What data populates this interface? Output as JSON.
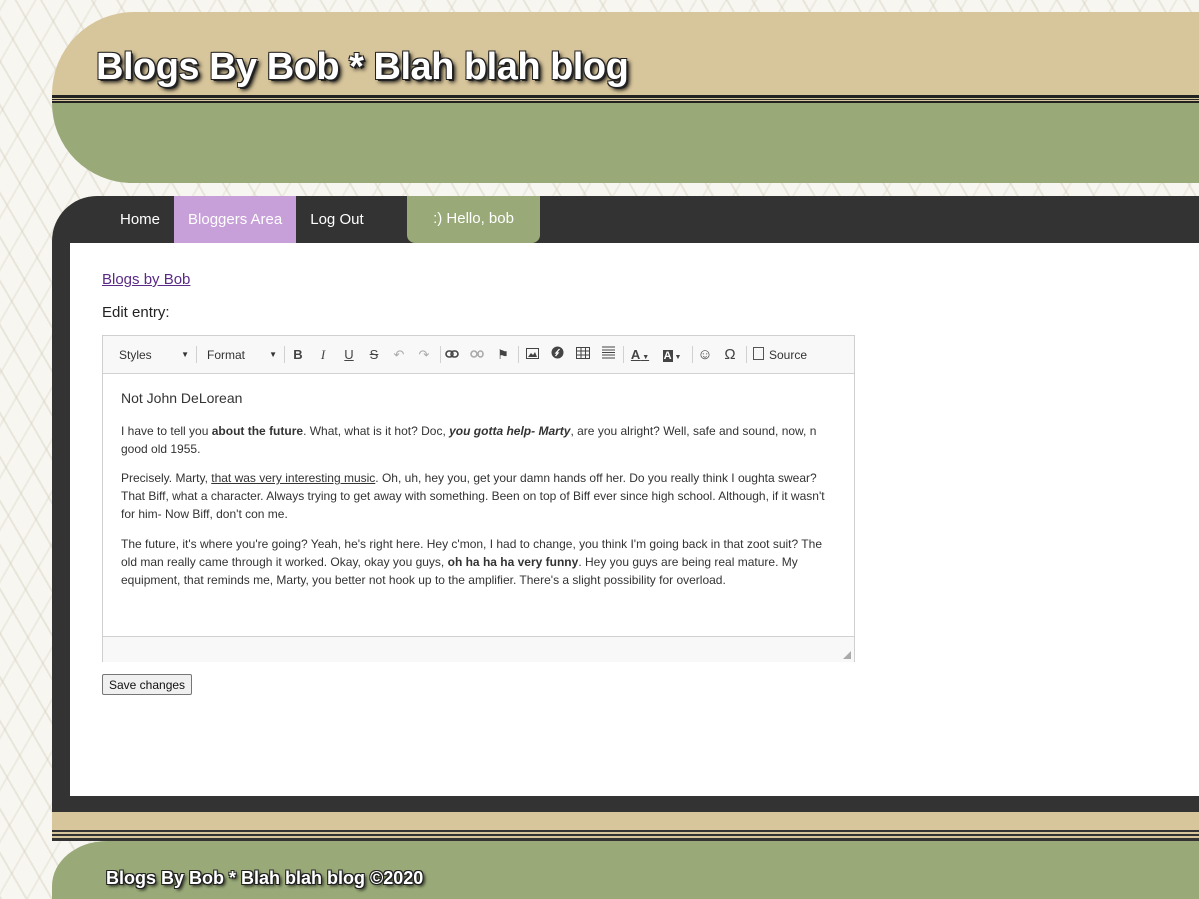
{
  "header": {
    "title": "Blogs By Bob * Blah blah blog"
  },
  "nav": {
    "items": [
      {
        "label": "Home",
        "active": false
      },
      {
        "label": "Bloggers Area",
        "active": true
      },
      {
        "label": "Log Out",
        "active": false
      }
    ],
    "greeting": ":)  Hello, bob"
  },
  "content": {
    "blog_link": "Blogs by Bob",
    "edit_label": "Edit entry:"
  },
  "editor": {
    "toolbar": {
      "styles_label": "Styles",
      "format_label": "Format",
      "source_label": "Source",
      "buttons": [
        "bold-icon",
        "italic-icon",
        "underline-icon",
        "strikethrough-icon",
        "undo-icon",
        "redo-icon",
        "link-icon",
        "unlink-icon",
        "anchor-flag-icon",
        "image-icon",
        "flash-icon",
        "table-icon",
        "horizontal-rule-icon",
        "text-color-icon",
        "background-color-icon",
        "smiley-icon",
        "special-char-icon"
      ]
    },
    "document": {
      "title": "Not John DeLorean",
      "p1": [
        {
          "text": "I have to tell you ",
          "style": "normal"
        },
        {
          "text": "about the future",
          "style": "bold"
        },
        {
          "text": ". What, what is it hot? Doc, ",
          "style": "normal"
        },
        {
          "text": "you gotta help- Marty",
          "style": "bold-italic"
        },
        {
          "text": ", are you alright? Well, safe and sound, now, n good old 1955.",
          "style": "normal"
        }
      ],
      "p2": [
        {
          "text": "Precisely. Marty, ",
          "style": "normal"
        },
        {
          "text": "that was very interesting music",
          "style": "underline"
        },
        {
          "text": ". Oh, uh, hey you, get your damn hands off her. Do you really think I oughta swear? That Biff, what a character. Always trying to get away with something. Been on top of Biff ever since high school. Although, if it wasn't for him- Now Biff, don't con me.",
          "style": "normal"
        }
      ],
      "p3": [
        {
          "text": "The future, it's where you're going? Yeah, he's right here. Hey c'mon, I had to change, you think I'm going back in that zoot suit? The old man really came through it worked. Okay, okay you guys, ",
          "style": "normal"
        },
        {
          "text": "oh ha ha ha very funny",
          "style": "bold"
        },
        {
          "text": ". Hey you guys are being real mature. My equipment, that reminds me, Marty, you better not hook up to the amplifier. There's a slight possibility for overload.",
          "style": "normal"
        }
      ]
    }
  },
  "actions": {
    "save_label": "Save changes"
  },
  "footer": {
    "text": "Blogs By Bob * Blah blah blog ©2020"
  },
  "colors": {
    "tan": "#d7c59b",
    "sage": "#99a978",
    "dark": "#333333",
    "active_nav": "#c79fd9",
    "link": "#5b2a86"
  }
}
